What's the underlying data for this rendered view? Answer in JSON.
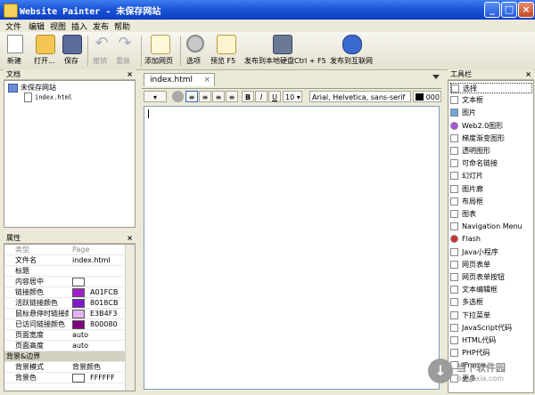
{
  "window": {
    "title": "Website Painter - 未保存网站",
    "min": "_",
    "max": "□",
    "close": "×"
  },
  "menu": [
    "文件",
    "编辑",
    "视图",
    "插入",
    "发布",
    "帮助"
  ],
  "toolbar": {
    "new": "新建",
    "open": "打开...",
    "save": "保存",
    "undo": "撤销",
    "redo": "重做",
    "add_page": "添加网页",
    "options": "选项",
    "preview": "预览 F5",
    "publish_local": "发布到本地硬盘Ctrl + F5",
    "publish_web": "发布到互联网"
  },
  "docs": {
    "header": "文档",
    "close": "×",
    "root": "未保存网站",
    "child": "index.html"
  },
  "props": {
    "header": "属性",
    "close": "×",
    "rows": [
      {
        "k": "类型",
        "v": "Page",
        "gray": true
      },
      {
        "k": "文件名",
        "v": "index.html"
      },
      {
        "k": "标题",
        "v": ""
      },
      {
        "k": "内容居中",
        "v": ""
      },
      {
        "k": "链接颜色",
        "v": "A01FCB",
        "color": "#a01fcb"
      },
      {
        "k": "活跃链接颜色",
        "v": "8018CB",
        "color": "#8018cb"
      },
      {
        "k": "鼠标悬停时链接颜",
        "v": "E3B4F3",
        "color": "#e3b4f3"
      },
      {
        "k": "已访问链接颜色",
        "v": "800080",
        "color": "#800080"
      },
      {
        "k": "页面宽度",
        "v": "auto"
      },
      {
        "k": "页面高度",
        "v": "auto"
      },
      {
        "k": "背景&边界",
        "v": "",
        "section": true
      },
      {
        "k": "背景模式",
        "v": "背景颜色"
      },
      {
        "k": "背景色",
        "v": "FFFFFF",
        "color": "#ffffff"
      }
    ]
  },
  "editor": {
    "tab": "index.html",
    "tab_close": "×",
    "font_size": "10",
    "font_family": "Arial, Helvetica, sans-serif",
    "color_value": "000"
  },
  "toolbox": {
    "header": "工具栏",
    "close": "×",
    "items": [
      "选择",
      "文本框",
      "图片",
      "Web2.0图形",
      "梯度渐变图形",
      "透明图形",
      "可命名链接",
      "幻灯片",
      "图片廊",
      "布局框",
      "图表",
      "Navigation Menu",
      "Flash",
      "Java小程序",
      "网页表单",
      "网页表单按钮",
      "文本编辑框",
      "多选框",
      "下拉菜单",
      "JavaScript代码",
      "HTML代码",
      "PHP代码",
      "IFrame",
      "更多"
    ]
  },
  "watermark": {
    "logo": "↓",
    "text": "当下软件园",
    "sub": "downxia.com"
  }
}
